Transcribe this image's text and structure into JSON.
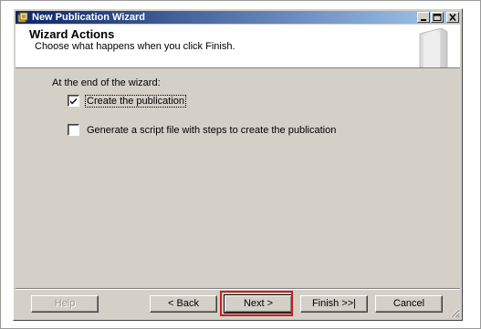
{
  "window": {
    "title": "New Publication Wizard",
    "title_icon": "wizard-app-icon",
    "controls": [
      "minimize-icon",
      "maximize-icon",
      "close-icon"
    ]
  },
  "header": {
    "title": "Wizard Actions",
    "subtitle": "Choose what happens when you click Finish.",
    "graphic": "wizard-book-graphic"
  },
  "options": {
    "group_label": "At the end of the wizard:",
    "items": [
      {
        "label": "Create the publication",
        "checked": true,
        "focused": true
      },
      {
        "label": "Generate a script file with steps to create the publication",
        "checked": false,
        "focused": false
      }
    ]
  },
  "buttons": {
    "help": "Help",
    "back": "< Back",
    "next": "Next >",
    "finish": "Finish >>|",
    "cancel": "Cancel"
  },
  "colors": {
    "dialog_face": "#d4d0c8",
    "titlebar_start": "#0a246a",
    "titlebar_end": "#a6caf0",
    "highlight": "#cc1c1c"
  }
}
